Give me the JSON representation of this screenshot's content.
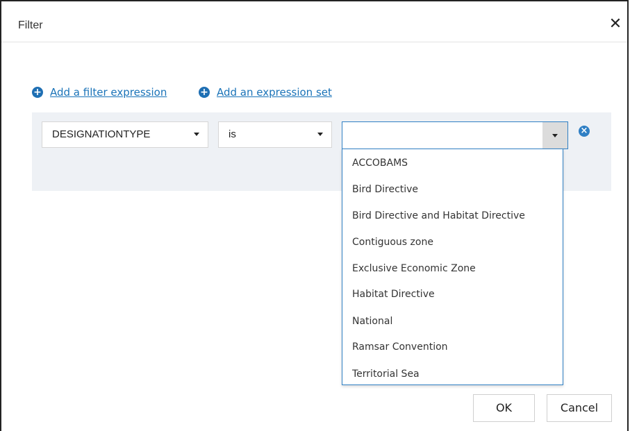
{
  "dialog": {
    "title": "Filter",
    "close_glyph": "✕"
  },
  "links": {
    "add_filter_expression": "Add a filter expression",
    "add_expression_set": "Add an expression set"
  },
  "expression": {
    "field": "DESIGNATIONTYPE",
    "operator": "is",
    "value": ""
  },
  "dropdown": {
    "options": [
      "ACCOBAMS",
      "Bird Directive",
      "Bird Directive and Habitat Directive",
      "Contiguous zone",
      "Exclusive Economic Zone",
      "Habitat Directive",
      "National",
      "Ramsar Convention",
      "Territorial Sea"
    ]
  },
  "buttons": {
    "ok": "OK",
    "cancel": "Cancel"
  },
  "icons": {
    "add": "plus-circle-icon",
    "remove": "x-circle-icon",
    "caret": "caret-down-icon",
    "close": "close-icon"
  },
  "colors": {
    "link": "#1a73b8",
    "accent": "#2f7fc4",
    "panel": "#eef1f5"
  }
}
